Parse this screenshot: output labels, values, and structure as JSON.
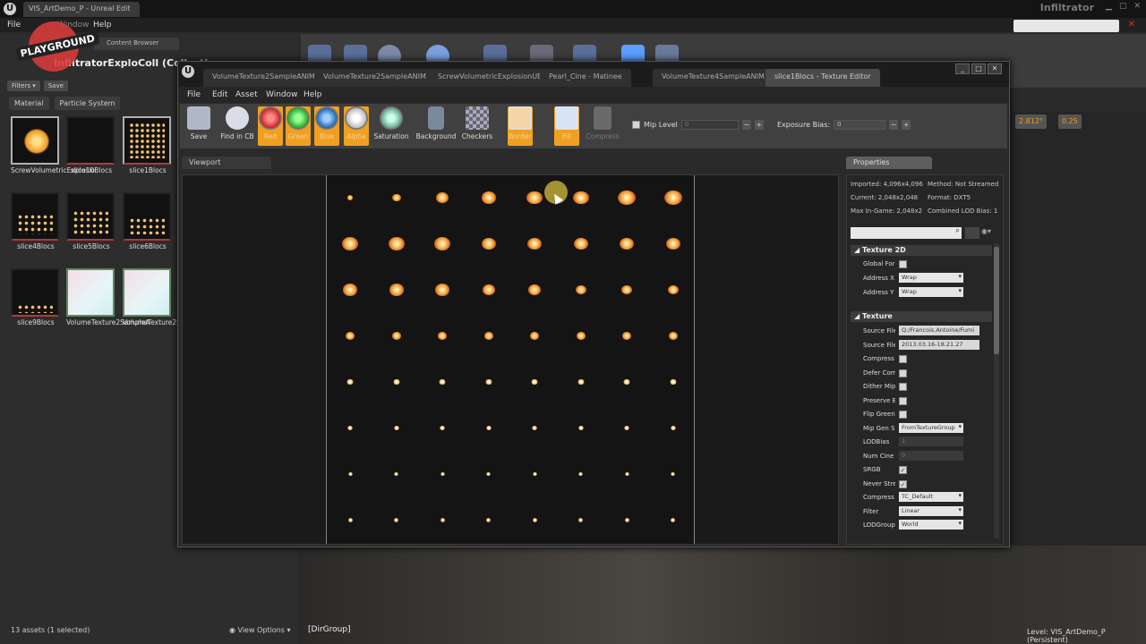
{
  "main": {
    "tab_title": "VIS_ArtDemo_P - Unreal Edit",
    "app_name": "Infiltrator",
    "menu": [
      "File",
      "Window",
      "Help"
    ]
  },
  "content_browser": {
    "tab": "Content Browser",
    "collection": "InfiltratorExploColl (Collectio",
    "filters": "Filters ▾",
    "save": "Save",
    "types": [
      "Material",
      "Particle System"
    ],
    "assets": [
      {
        "name": "ScrewVolumetricExplosio"
      },
      {
        "name": "slice10Blocs"
      },
      {
        "name": "slice1Blocs"
      },
      {
        "name": "slice4Blocs"
      },
      {
        "name": "slice5Blocs"
      },
      {
        "name": "slice6Blocs"
      },
      {
        "name": "slice9Blocs"
      },
      {
        "name": "VolumeTexture2SampleA"
      },
      {
        "name": "VolumeTexture2SampleA"
      }
    ],
    "footer": "13 assets (1 selected)",
    "view_options": "◉ View Options ▾"
  },
  "watermark": "PLAYGROUND",
  "texture_editor": {
    "tabs": [
      "VolumeTexture2SampleANIM",
      "VolumeTexture2SampleANIM",
      "ScrewVolumetricExplosionUE",
      "Pearl_Cine - Matinee",
      "VolumeTexture4SampleANIM",
      "slice1Blocs - Texture Editor"
    ],
    "menu": [
      "File",
      "Edit",
      "Asset",
      "Window",
      "Help"
    ],
    "tools": [
      {
        "label": "Save",
        "icon": "save-icon"
      },
      {
        "label": "Find in CB",
        "icon": "find-icon"
      },
      {
        "label": "Red",
        "icon": "red-channel-icon"
      },
      {
        "label": "Green",
        "icon": "green-channel-icon"
      },
      {
        "label": "Blue",
        "icon": "blue-channel-icon"
      },
      {
        "label": "Alpha",
        "icon": "alpha-channel-icon"
      },
      {
        "label": "Saturation",
        "icon": "saturation-icon"
      },
      {
        "label": "Background",
        "icon": "background-icon"
      },
      {
        "label": "Checkers",
        "icon": "checkers-icon"
      },
      {
        "label": "Border",
        "icon": "border-icon"
      },
      {
        "label": "Fill",
        "icon": "fill-icon"
      },
      {
        "label": "Compress",
        "icon": "compress-icon"
      }
    ],
    "mip_level_label": "Mip Level",
    "mip_level_value": "0",
    "exposure_label": "Exposure Bias:",
    "exposure_value": "0",
    "viewport_tab": "Viewport",
    "properties_tab": "Properties",
    "info": {
      "imported": "Imported: 4,096x4,096",
      "method": "Method: Not Streamed",
      "current": "Current: 2,048x2,048",
      "format": "Format: DXT5",
      "max_ingame": "Max In-Game: 2,048x2",
      "lod_bias": "Combined LOD Bias: 1"
    },
    "texture2d_header": "Texture 2D",
    "texture_header": "Texture",
    "props_t2d": [
      {
        "label": "Global For",
        "type": "check",
        "value": ""
      },
      {
        "label": "Address X",
        "type": "dropdown",
        "value": "Wrap"
      },
      {
        "label": "Address Y",
        "type": "dropdown",
        "value": "Wrap"
      }
    ],
    "props_tex": [
      {
        "label": "Source File",
        "type": "text",
        "value": "Q:/Francois.Antoine/Fumi"
      },
      {
        "label": "Source File",
        "type": "text",
        "value": "2013.03.16-18.21.27"
      },
      {
        "label": "Compress",
        "type": "check",
        "value": ""
      },
      {
        "label": "Defer Com",
        "type": "check",
        "value": ""
      },
      {
        "label": "Dither Mip",
        "type": "check",
        "value": ""
      },
      {
        "label": "Preserve B",
        "type": "check",
        "value": ""
      },
      {
        "label": "Flip Green",
        "type": "check",
        "value": ""
      },
      {
        "label": "Mip Gen S",
        "type": "dropdown",
        "value": "FromTextureGroup"
      },
      {
        "label": "LODBias",
        "type": "number",
        "value": "1"
      },
      {
        "label": "Num Cine",
        "type": "number",
        "value": "0"
      },
      {
        "label": "SRGB",
        "type": "check",
        "value": "✓"
      },
      {
        "label": "Never Stre",
        "type": "check",
        "value": "✓"
      },
      {
        "label": "Compress",
        "type": "dropdown",
        "value": "TC_Default"
      },
      {
        "label": "Filter",
        "type": "dropdown",
        "value": "Linear"
      },
      {
        "label": "LODGroup",
        "type": "dropdown",
        "value": "World"
      }
    ]
  },
  "background": {
    "dirgroup": "[DirGroup]",
    "level": "Level:  VIS_ArtDemo_P (Persistent)",
    "right_chips": [
      "2.812°",
      "0.25"
    ]
  }
}
